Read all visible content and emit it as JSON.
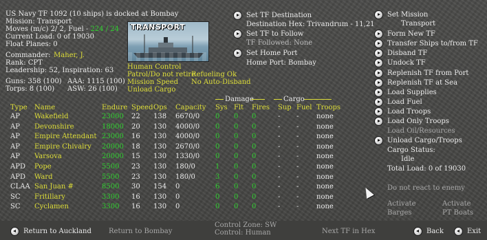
{
  "header": {
    "title": "US Navy TF 1092 (10 ships) is docked at Bombay",
    "mission": "Mission:  Transport",
    "moves_prefix": "Moves (m/c) 2/ 2, Fuel - ",
    "moves_fuel": "224 / 24",
    "current_load": "Current Load: 0 of 19030",
    "float_planes": "Float Planes: 0",
    "commander_label": "Commander:",
    "commander_name": "Maher, J.",
    "rank": "Rank: CPT",
    "leadership": "Leadership: 52, Inspiration: 63",
    "guns": "Guns: 358 (100)",
    "aaa": "AAA: 1115 (100)",
    "torps": "Torps: 8 (100)",
    "asw": "ASW: 26 (100)"
  },
  "ship_image": {
    "label": "TRANSPORT"
  },
  "orders": {
    "human_control": "Human Control",
    "patrol": "Patrol/Do not retire",
    "refueling": "Refueling Ok",
    "mission_speed": "Mission Speed",
    "no_auto_disband": "No Auto-Disband",
    "unload_cargo": "Unload Cargo"
  },
  "tf_panel": {
    "set_destination": "Set TF Destination",
    "destination_hex": "Destination Hex: Trivandrum - 11,21",
    "set_follow": "Set TF to Follow",
    "tf_followed": "TF Followed: None",
    "set_home": "Set Home Port",
    "home_port": "Home Port: Bombay"
  },
  "right_menu": {
    "set_mission": "Set Mission",
    "mission_value": "Transport",
    "form_new": "Form New TF",
    "transfer": "Transfer Ships to/from TF",
    "disband": "Disband TF",
    "undock": "Undock TF",
    "replenish_port": "Replenish TF from Port",
    "replenish_sea": "Replenish TF at Sea",
    "load_supplies": "Load Supplies",
    "load_fuel": "Load Fuel",
    "load_troops": "Load Troops",
    "load_only_troops": "Load Only Troops",
    "load_oil": "Load Oil/Resources",
    "unload": "Unload Cargo/Troops",
    "cargo_status": "Cargo Status:",
    "cargo_status_value": "Idle",
    "total_load": "Total Load: 0 of 19030",
    "no_react": "Do not react to enemy",
    "activate1": "Activate",
    "barges": "Barges",
    "activate2": "Activate",
    "pt_boats": "PT Boats"
  },
  "table": {
    "group_damage": "Damage",
    "group_cargo": "Cargo",
    "columns": [
      "Type",
      "Name",
      "Endure",
      "Speed",
      "Ops",
      "Capacity",
      "Sys",
      "Flt",
      "Fires",
      "Sup",
      "Fuel",
      "Troops"
    ],
    "rows": [
      [
        "AP",
        "Wakefield",
        "23000",
        "22",
        "138",
        "6670/0",
        "0",
        "0",
        "0",
        "-",
        "-",
        "none"
      ],
      [
        "AP",
        "Devonshire",
        "18000",
        "20",
        "130",
        "4000/0",
        "0",
        "0",
        "0",
        "-",
        "-",
        "none"
      ],
      [
        "AP",
        "Empire Attendant",
        "23000",
        "16",
        "130",
        "4000/0",
        "0",
        "0",
        "0",
        "-",
        "-",
        "none"
      ],
      [
        "AP",
        "Empire Chivalry",
        "20000",
        "18",
        "130",
        "2670/0",
        "0",
        "0",
        "0",
        "-",
        "-",
        "none"
      ],
      [
        "AP",
        "Varsova",
        "20000",
        "15",
        "130",
        "1330/0",
        "0",
        "0",
        "0",
        "-",
        "-",
        "none"
      ],
      [
        "APD",
        "Pope",
        "5500",
        "23",
        "130",
        "180/0",
        "1",
        "0",
        "0",
        "-",
        "-",
        "none"
      ],
      [
        "APD",
        "Ward",
        "5500",
        "23",
        "130",
        "180/0",
        "3",
        "0",
        "0",
        "-",
        "-",
        "none"
      ],
      [
        "CLAA",
        "San Juan #",
        "8500",
        "30",
        "154",
        "0",
        "6",
        "0",
        "0",
        "-",
        "-",
        "none"
      ],
      [
        "SC",
        "Fritillary",
        "3300",
        "16",
        "130",
        "0",
        "0",
        "0",
        "0",
        "-",
        "-",
        "none"
      ],
      [
        "SC",
        "Cyclamen",
        "3300",
        "16",
        "130",
        "0",
        "0",
        "0",
        "0",
        "-",
        "-",
        "none"
      ]
    ]
  },
  "bottom": {
    "return_auckland": "Return to Auckland",
    "return_bombay": "Return to Bombay",
    "control_zone": "Control Zone: SW",
    "control": "Control:      Human",
    "next_tf": "Next TF in Hex",
    "back": "Back",
    "exit": "Exit"
  },
  "colors": {
    "yellow": "#dede38",
    "green": "#30d030",
    "white": "#ececec",
    "grey": "#a8a8a8"
  }
}
